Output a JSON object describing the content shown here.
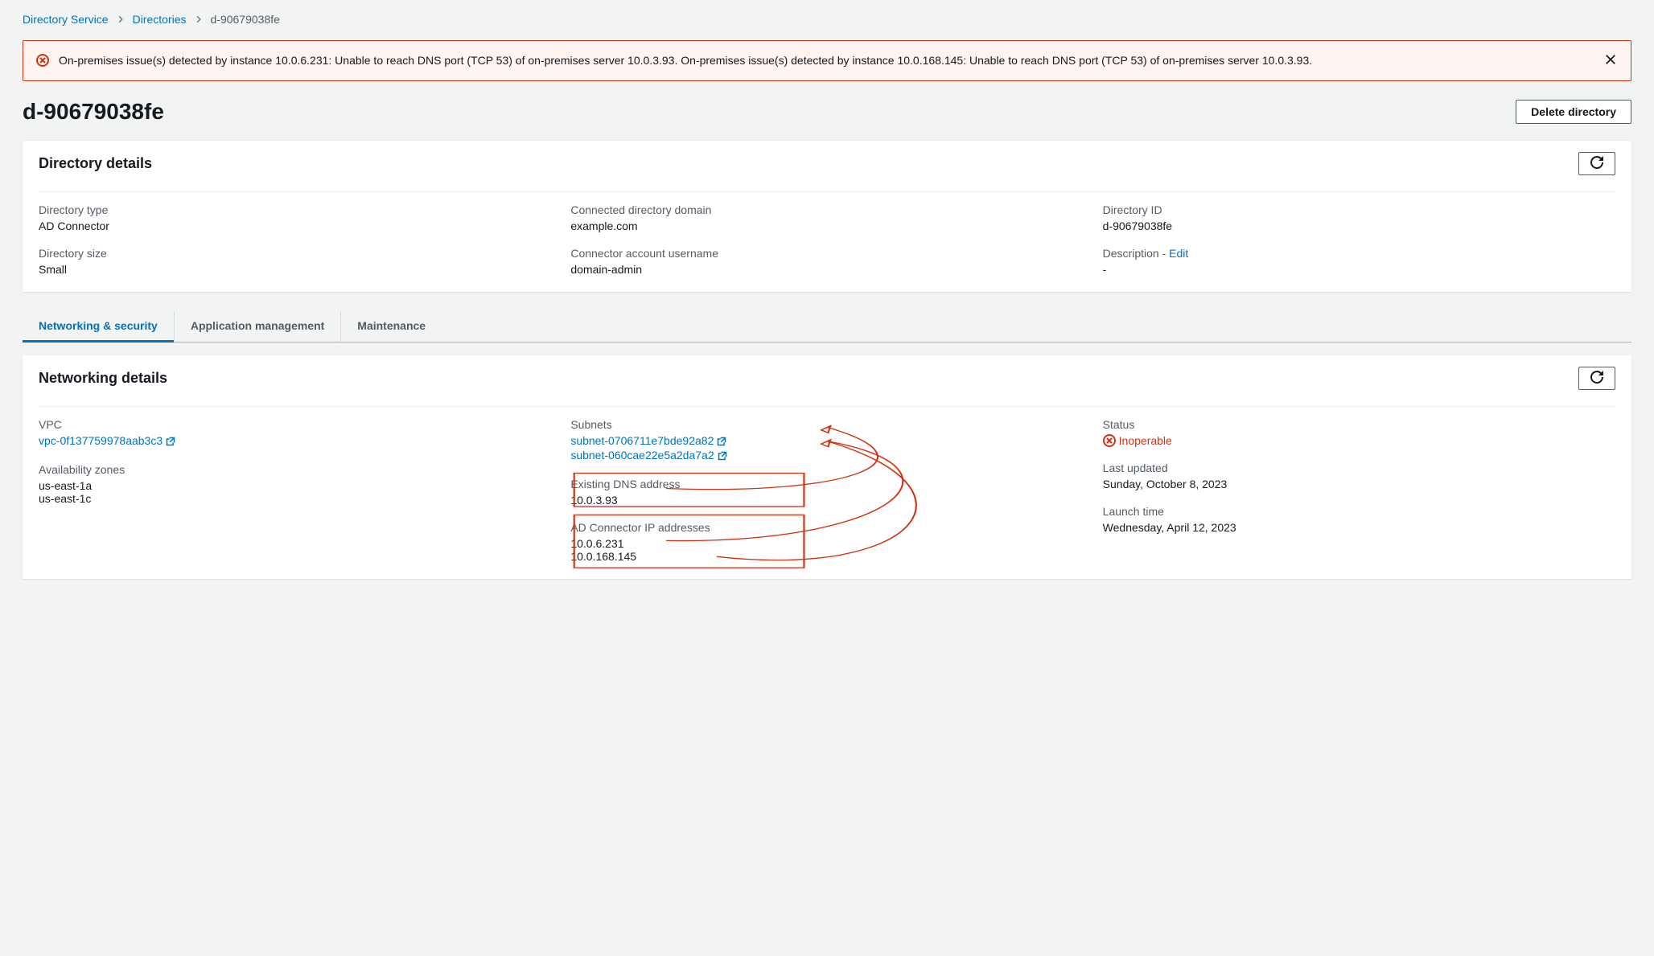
{
  "breadcrumbs": {
    "service": "Directory Service",
    "directories": "Directories",
    "current": "d-90679038fe"
  },
  "alert": {
    "text": "On-premises issue(s) detected by instance 10.0.6.231: Unable to reach DNS port (TCP 53) of on-premises server 10.0.3.93. On-premises issue(s) detected by instance 10.0.168.145: Unable to reach DNS port (TCP 53) of on-premises server 10.0.3.93."
  },
  "page_title": "d-90679038fe",
  "actions": {
    "delete": "Delete directory"
  },
  "directory_details": {
    "header": "Directory details",
    "type_label": "Directory type",
    "type_value": "AD Connector",
    "size_label": "Directory size",
    "size_value": "Small",
    "domain_label": "Connected directory domain",
    "domain_value": "example.com",
    "username_label": "Connector account username",
    "username_value": "domain-admin",
    "id_label": "Directory ID",
    "id_value": "d-90679038fe",
    "desc_label_prefix": "Description - ",
    "desc_edit": "Edit",
    "desc_value": "-"
  },
  "tabs": {
    "networking": "Networking & security",
    "app": "Application management",
    "maintenance": "Maintenance"
  },
  "networking_details": {
    "header": "Networking details",
    "vpc_label": "VPC",
    "vpc_value": "vpc-0f137759978aab3c3",
    "az_label": "Availability zones",
    "az_values": [
      "us-east-1a",
      "us-east-1c"
    ],
    "subnets_label": "Subnets",
    "subnets_values": [
      "subnet-0706711e7bde92a82",
      "subnet-060cae22e5a2da7a2"
    ],
    "dns_label": "Existing DNS address",
    "dns_value": "10.0.3.93",
    "adip_label": "AD Connector IP addresses",
    "adip_values": [
      "10.0.6.231",
      "10.0.168.145"
    ],
    "status_label": "Status",
    "status_value": "Inoperable",
    "updated_label": "Last updated",
    "updated_value": "Sunday, October 8, 2023",
    "launch_label": "Launch time",
    "launch_value": "Wednesday, April 12, 2023"
  }
}
